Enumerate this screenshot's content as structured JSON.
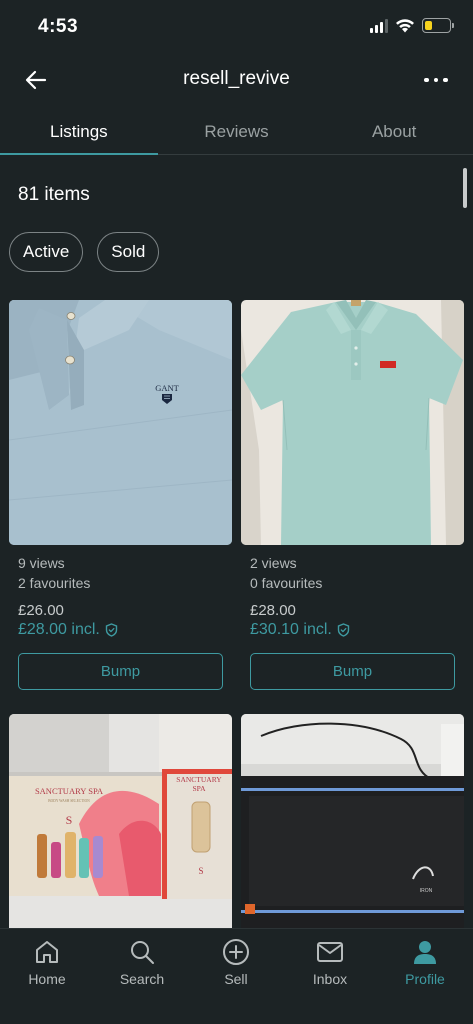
{
  "status_bar": {
    "time": "4:53"
  },
  "header": {
    "title": "resell_revive"
  },
  "tabs": [
    {
      "label": "Listings"
    },
    {
      "label": "Reviews"
    },
    {
      "label": "About"
    }
  ],
  "items_count": "81 items",
  "filters": [
    {
      "label": "Active"
    },
    {
      "label": "Sold"
    }
  ],
  "listings": [
    {
      "views": "9 views",
      "favourites": "2 favourites",
      "price": "£26.00",
      "price_incl": "£28.00 incl.",
      "bump_label": "Bump",
      "logo_text": "GANT"
    },
    {
      "views": "2 views",
      "favourites": "0 favourites",
      "price": "£28.00",
      "price_incl": "£30.10 incl.",
      "bump_label": "Bump"
    },
    {
      "box_brand": "SANCTUARY SPA",
      "box_sub": "BODY WASH SELECTION",
      "box_letter": "S"
    },
    {
      "device_text": "IRON"
    }
  ],
  "bottom_nav": [
    {
      "label": "Home",
      "icon": "home-icon"
    },
    {
      "label": "Search",
      "icon": "search-icon"
    },
    {
      "label": "Sell",
      "icon": "plus-circle-icon"
    },
    {
      "label": "Inbox",
      "icon": "mail-icon"
    },
    {
      "label": "Profile",
      "icon": "profile-icon"
    }
  ],
  "colors": {
    "background": "#1c2325",
    "accent": "#3e9aa1",
    "battery": "#f7d31e"
  }
}
